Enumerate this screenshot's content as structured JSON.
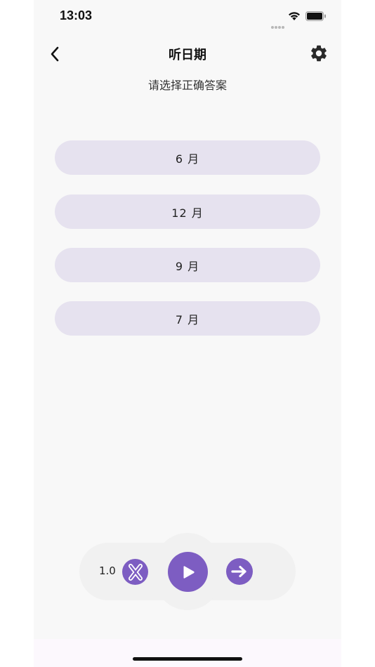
{
  "status_bar": {
    "time": "13:03"
  },
  "header": {
    "title": "听日期",
    "subtitle": "请选择正确答案"
  },
  "options": [
    {
      "label": "6 月"
    },
    {
      "label": "12 月"
    },
    {
      "label": "9 月"
    },
    {
      "label": "7 月"
    }
  ],
  "controls": {
    "speed": "1.0"
  },
  "icons": {
    "back": "chevron-left-icon",
    "settings": "gear-icon",
    "close": "x-icon",
    "play": "play-icon",
    "next": "arrow-right-icon"
  },
  "colors": {
    "accent": "#7d5dc2",
    "option_bg": "#e6e2ef",
    "background": "#f8f8f8"
  }
}
